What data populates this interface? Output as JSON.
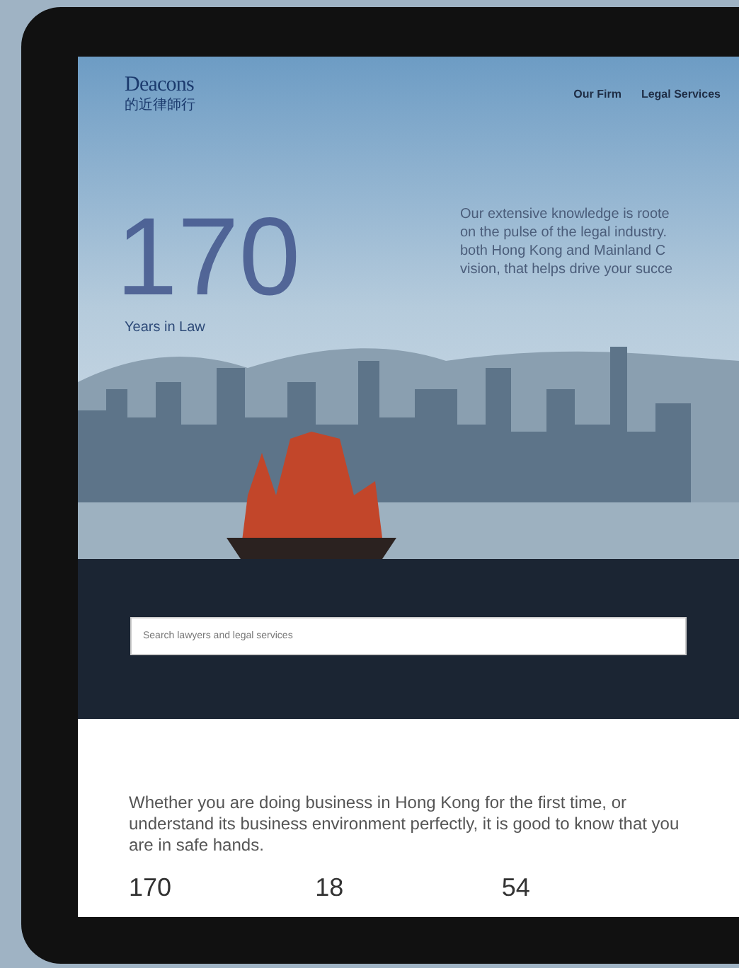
{
  "header": {
    "logo": "Deacons",
    "logo_subtitle": "的近律師行",
    "nav": [
      {
        "label": "Our Firm"
      },
      {
        "label": "Legal Services"
      }
    ]
  },
  "hero": {
    "big_number": "170",
    "caption": "Years in Law",
    "intro_lines": [
      "Our extensive knowledge is roote",
      "on the pulse of the legal industry.",
      "both Hong Kong and Mainland C",
      "vision, that helps drive your succe"
    ]
  },
  "search": {
    "placeholder": "Search lawyers and legal services"
  },
  "about": {
    "text": "Whether you are doing business in Hong Kong for the first time, or understand its business environment perfectly, it is good to know that you are in safe hands.",
    "stats": [
      "170",
      "18",
      "54"
    ]
  }
}
